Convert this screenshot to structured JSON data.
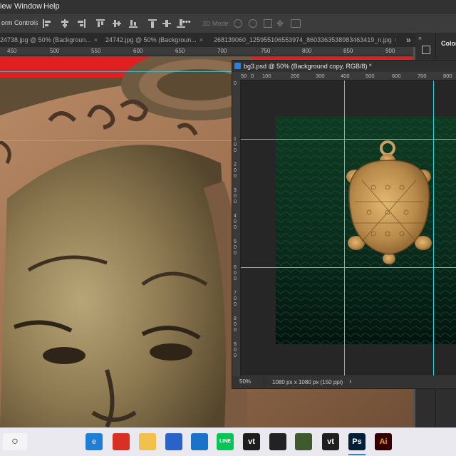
{
  "menubar": {
    "items": [
      "iew",
      "Window",
      "Help"
    ]
  },
  "options_bar": {
    "transform_label": "orm Controls",
    "mode_label": "3D Mode:",
    "more": "•••"
  },
  "tabs": [
    {
      "label": "24738.jpg @ 50% (Backgroun...",
      "close": "×"
    },
    {
      "label": "24742.jpg @ 50% (Backgroun...",
      "close": "×"
    },
    {
      "label": "268139060_125955106553974_8603363538983463419_n.jpg",
      "close": "×"
    }
  ],
  "tab_overflow": "»",
  "main_ruler": [
    "450",
    "500",
    "550",
    "600",
    "650",
    "700",
    "750",
    "800",
    "850",
    "900"
  ],
  "doc_window": {
    "title": "bg3.psd @ 50% (Background copy, RGB/8) *",
    "ruler_h": [
      "0",
      "100",
      "200",
      "300",
      "400",
      "500",
      "600",
      "700",
      "800"
    ],
    "ruler_h_prefix": "50",
    "ruler_v": [
      "0",
      "1 0 0",
      "2 0 0",
      "3 0 0",
      "4 0 0",
      "5 0 0",
      "6 0 0",
      "7 0 0",
      "8 0 0",
      "9 0 0"
    ],
    "zoom": "50%",
    "doc_size": "1080 px x 1080 px (150 ppi)",
    "status_arrow": "›"
  },
  "right_panel": {
    "label": "Color",
    "collapse": "«"
  },
  "taskbar": {
    "search_icon": "○",
    "apps": [
      {
        "name": "edge",
        "label": "e",
        "color": "#1f7fd6"
      },
      {
        "name": "chrome",
        "label": "",
        "color": "#d93025"
      },
      {
        "name": "explorer",
        "label": "",
        "color": "#f2c14b"
      },
      {
        "name": "store",
        "label": "",
        "color": "#2a62c9"
      },
      {
        "name": "mail",
        "label": "",
        "color": "#1a73c9"
      },
      {
        "name": "line",
        "label": "LINE",
        "color": "#06c755"
      },
      {
        "name": "vt1",
        "label": "vt",
        "color": "#1e1e1e"
      },
      {
        "name": "obs",
        "label": "",
        "color": "#222222"
      },
      {
        "name": "app-green",
        "label": "",
        "color": "#3e5a2e"
      },
      {
        "name": "vt2",
        "label": "vt",
        "color": "#1e1e1e"
      },
      {
        "name": "photoshop",
        "label": "Ps",
        "color": "#31a8ff"
      },
      {
        "name": "illustrator",
        "label": "Ai",
        "color": "#ff9a00"
      }
    ]
  }
}
